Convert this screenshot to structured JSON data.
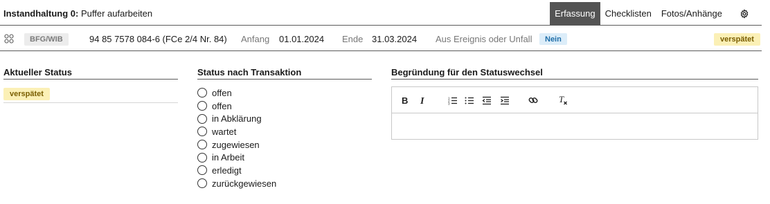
{
  "header": {
    "title_prefix": "Instandhaltung 0:",
    "title_suffix": "Puffer aufarbeiten",
    "tabs": [
      {
        "label": "Erfassung",
        "active": true
      },
      {
        "label": "Checklisten",
        "active": false
      },
      {
        "label": "Fotos/Anhänge",
        "active": false
      }
    ],
    "settings_icon": "gear-icon"
  },
  "info": {
    "drag_icon": "drag-handle-icon",
    "org_badge": "BFG/WIB",
    "vehicle": "94 85 7578 084-6 (FCe 2/4 Nr. 84)",
    "start_label": "Anfang",
    "start_value": "01.01.2024",
    "end_label": "Ende",
    "end_value": "31.03.2024",
    "event_label": "Aus Ereignis oder Unfall",
    "event_value": "Nein",
    "status": "verspätet"
  },
  "current_status": {
    "heading": "Aktueller Status",
    "value": "verspätet"
  },
  "transition": {
    "heading": "Status nach Transaktion",
    "options": [
      "offen",
      "offen",
      "in Abklärung",
      "wartet",
      "zugewiesen",
      "in Arbeit",
      "erledigt",
      "zurückgewiesen"
    ]
  },
  "reason": {
    "heading": "Begründung für den Statuswechsel",
    "toolbar": [
      "bold-icon",
      "italic-icon",
      "ordered-list-icon",
      "bullet-list-icon",
      "outdent-icon",
      "indent-icon",
      "link-icon",
      "clear-format-icon"
    ],
    "text": ""
  },
  "colors": {
    "active_tab": "#545454",
    "late_badge_bg": "#fbf0b6",
    "late_badge_fg": "#7a5e00",
    "no_badge_bg": "#dcedf9",
    "no_badge_fg": "#1f6ea8"
  }
}
